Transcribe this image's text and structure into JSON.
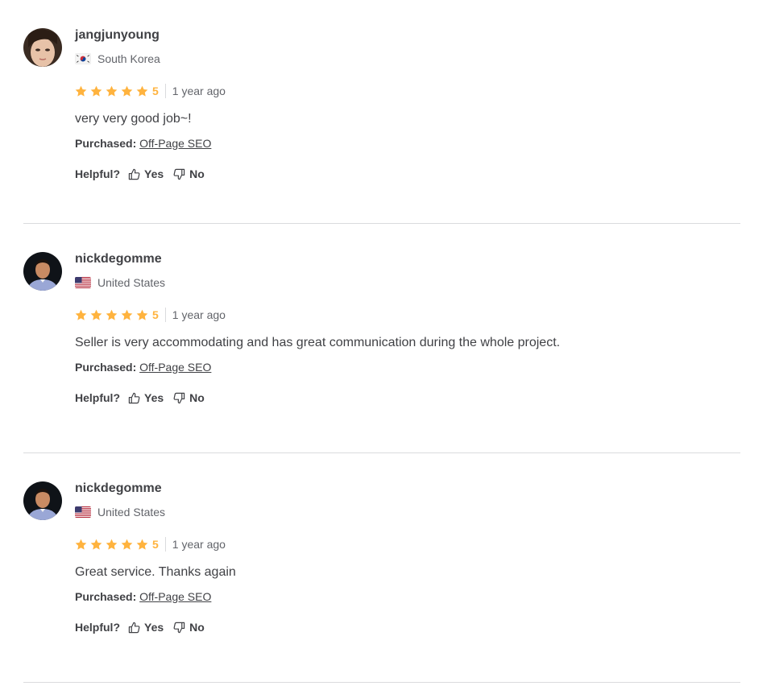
{
  "reviews": [
    {
      "username": "jangjunyoung",
      "country": "South Korea",
      "flag": "south-korea-flag-icon",
      "rating": 5,
      "rating_label": "5",
      "time": "1 year ago",
      "text": "very very good job~!",
      "purchased_label": "Purchased:",
      "purchased_item": "Off-Page SEO",
      "helpful_label": "Helpful?",
      "yes_label": "Yes",
      "no_label": "No"
    },
    {
      "username": "nickdegomme",
      "country": "United States",
      "flag": "united-states-flag-icon",
      "rating": 5,
      "rating_label": "5",
      "time": "1 year ago",
      "text": "Seller is very accommodating and has great communication during the whole project.",
      "purchased_label": "Purchased:",
      "purchased_item": "Off-Page SEO",
      "helpful_label": "Helpful?",
      "yes_label": "Yes",
      "no_label": "No"
    },
    {
      "username": "nickdegomme",
      "country": "United States",
      "flag": "united-states-flag-icon",
      "rating": 5,
      "rating_label": "5",
      "time": "1 year ago",
      "text": "Great service. Thanks again",
      "purchased_label": "Purchased:",
      "purchased_item": "Off-Page SEO",
      "helpful_label": "Helpful?",
      "yes_label": "Yes",
      "no_label": "No"
    }
  ],
  "colors": {
    "star": "#ffb33e",
    "text": "#404145",
    "muted": "#62646a",
    "divider": "#dadbdd"
  }
}
